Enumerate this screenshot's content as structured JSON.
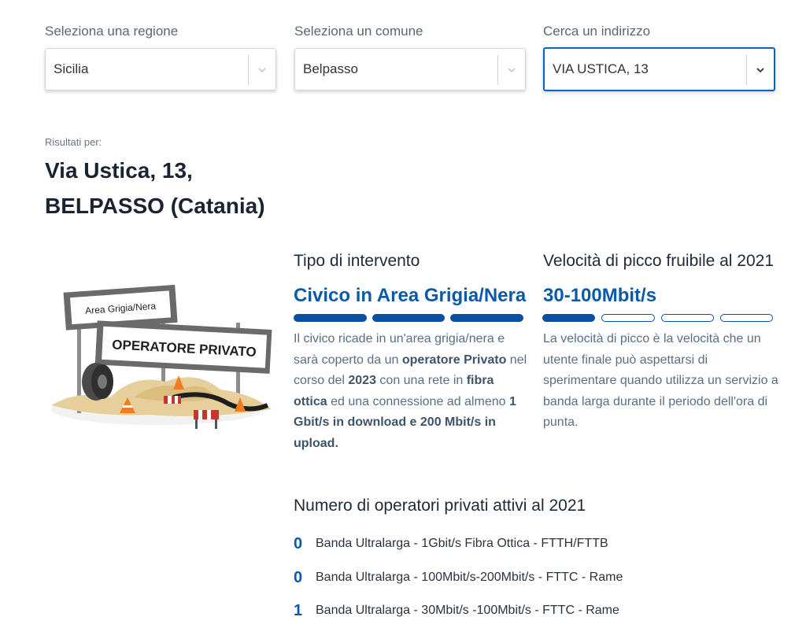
{
  "filters": {
    "region": {
      "label": "Seleziona una regione",
      "value": "Sicilia"
    },
    "municipality": {
      "label": "Seleziona un comune",
      "value": "Belpasso"
    },
    "address": {
      "label": "Cerca un indirizzo",
      "value": "VIA USTICA, 13"
    }
  },
  "results": {
    "label": "Risultati per:",
    "line1": "Via Ustica, 13,",
    "line2": "BELPASSO (Catania)"
  },
  "illustration": {
    "sign_small": "Area Grigia/Nera",
    "sign_big": "OPERATORE PRIVATO"
  },
  "intervention": {
    "title": "Tipo di intervento",
    "value": "Civico in Area Grigia/Nera",
    "level": {
      "filled": 3,
      "total": 3
    },
    "desc": {
      "t1": "Il civico ricade in un'area grigia/nera e sarà coperto da un ",
      "b1": "operatore Privato",
      "t2": " nel corso del ",
      "b2": "2023",
      "t3": " con una rete in ",
      "b3": "fibra ottica",
      "t4": " ed una connessione ad almeno ",
      "b4": "1 Gbit/s in download e 200 Mbit/s in upload."
    }
  },
  "speed": {
    "title": "Velocità di picco fruibile al 2021",
    "value": "30-100Mbit/s",
    "level": {
      "filled": 1,
      "total": 4
    },
    "desc": "La velocità di picco è la velocità che un utente finale può aspettarsi di sperimentare quando utilizza un servizio a banda larga durante il periodo dell'ora di punta."
  },
  "operators": {
    "title": "Numero di operatori privati attivi al 2021",
    "items": [
      {
        "count": "0",
        "label": "Banda Ultralarga - 1Gbit/s Fibra Ottica - FTTH/FTTB"
      },
      {
        "count": "0",
        "label": "Banda Ultralarga - 100Mbit/s-200Mbit/s - FTTC - Rame"
      },
      {
        "count": "1",
        "label": "Banda Ultralarga - 30Mbit/s -100Mbit/s - FTTC - Rame"
      }
    ]
  },
  "colors": {
    "accent": "#0a5aa8",
    "bar": "#0a4fa2"
  }
}
